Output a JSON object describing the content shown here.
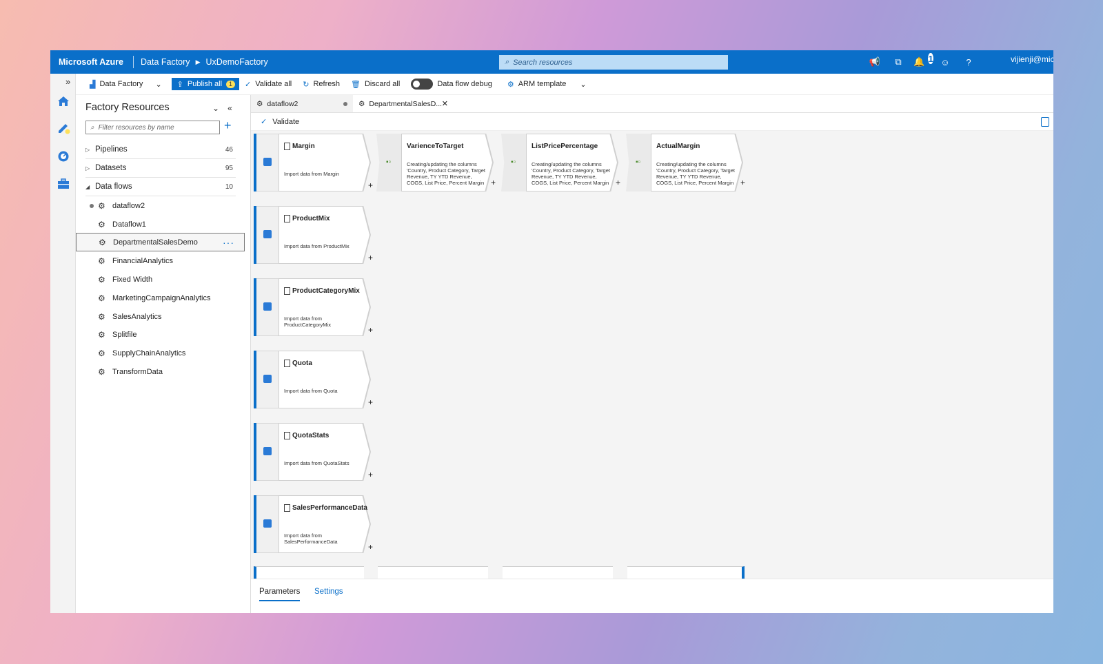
{
  "topbar": {
    "brand": "Microsoft Azure",
    "breadcrumb": [
      "Data Factory",
      "UxDemoFactory"
    ],
    "search_placeholder": "Search resources",
    "notification_count": "1",
    "user": "vijienji@mic"
  },
  "toolbar": {
    "factory": "Data Factory",
    "publish": "Publish all",
    "publish_count": "1",
    "validate_all": "Validate all",
    "refresh": "Refresh",
    "discard_all": "Discard all",
    "debug": "Data flow debug",
    "arm": "ARM template"
  },
  "panel": {
    "title": "Factory Resources",
    "filter_placeholder": "Filter resources by name",
    "groups": [
      {
        "label": "Pipelines",
        "count": "46"
      },
      {
        "label": "Datasets",
        "count": "95"
      },
      {
        "label": "Data flows",
        "count": "10"
      }
    ],
    "dataflows": [
      "dataflow2",
      "Dataflow1",
      "DepartmentalSalesDemo",
      "FinancialAnalytics",
      "Fixed Width",
      "MarketingCampaignAnalytics",
      "SalesAnalytics",
      "Splitfile",
      "SupplyChainAnalytics",
      "TransformData"
    ]
  },
  "tabs": [
    "dataflow2",
    "DepartmentalSalesD..."
  ],
  "editor": {
    "validate": "Validate"
  },
  "sources": [
    {
      "title": "Margin",
      "desc": "Import data from Margin"
    },
    {
      "title": "ProductMix",
      "desc": "Import data from ProductMix"
    },
    {
      "title": "ProductCategoryMix",
      "desc": "Import data from ProductCategoryMix"
    },
    {
      "title": "Quota",
      "desc": "Import data from Quota"
    },
    {
      "title": "QuotaStats",
      "desc": "Import data from QuotaStats"
    },
    {
      "title": "SalesPerformanceData",
      "desc": "Import data from SalesPerformanceData"
    }
  ],
  "transforms": [
    {
      "title": "VarienceToTarget",
      "desc": "Creating/updating the columns 'Country, Product Category, Target Revenue, TY YTD Revenue, COGS, List Price, Percent Margin"
    },
    {
      "title": "ListPricePercentage",
      "desc": "Creating/updating the columns 'Country, Product Category, Target Revenue, TY YTD Revenue, COGS, List Price, Percent Margin"
    },
    {
      "title": "ActualMargin",
      "desc": "Creating/updating the columns 'Country, Product Category, Target Revenue, TY YTD Revenue, COGS, List Price, Percent Margin"
    }
  ],
  "bottom_tabs": [
    "Parameters",
    "Settings"
  ],
  "colors": {
    "accent": "#0a6fc9",
    "badge": "#fde05b"
  }
}
